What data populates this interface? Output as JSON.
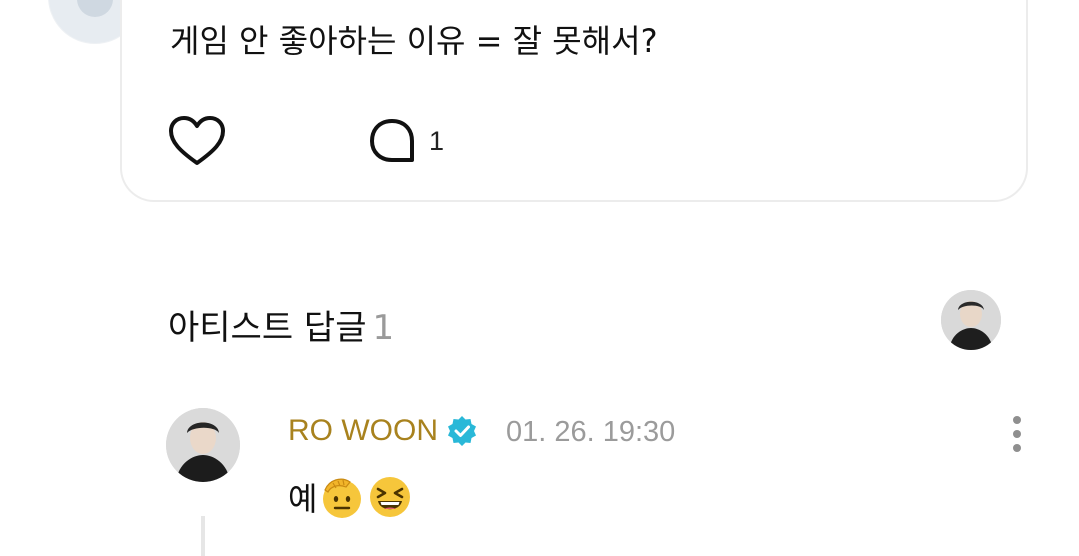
{
  "post": {
    "text": "게임 안 좋아하는 이유 = 잘 못해서?",
    "comment_count": "1"
  },
  "artist_replies": {
    "title": "아티스트 답글",
    "count": "1"
  },
  "reply": {
    "author": "RO WOON",
    "timestamp": "01. 26. 19:30",
    "text": "예"
  },
  "icons": {
    "like": "heart-outline-icon",
    "comment": "speech-bubble-outline-icon",
    "verified": "verified-badge-icon",
    "more": "vertical-dots-icon",
    "emoji_1": "saluting-face-emoji",
    "emoji_2": "grinning-squinting-face-emoji"
  },
  "colors": {
    "author_name": "#a8821e",
    "verified_badge": "#29b8d8",
    "muted_text": "#9b9b9b"
  }
}
